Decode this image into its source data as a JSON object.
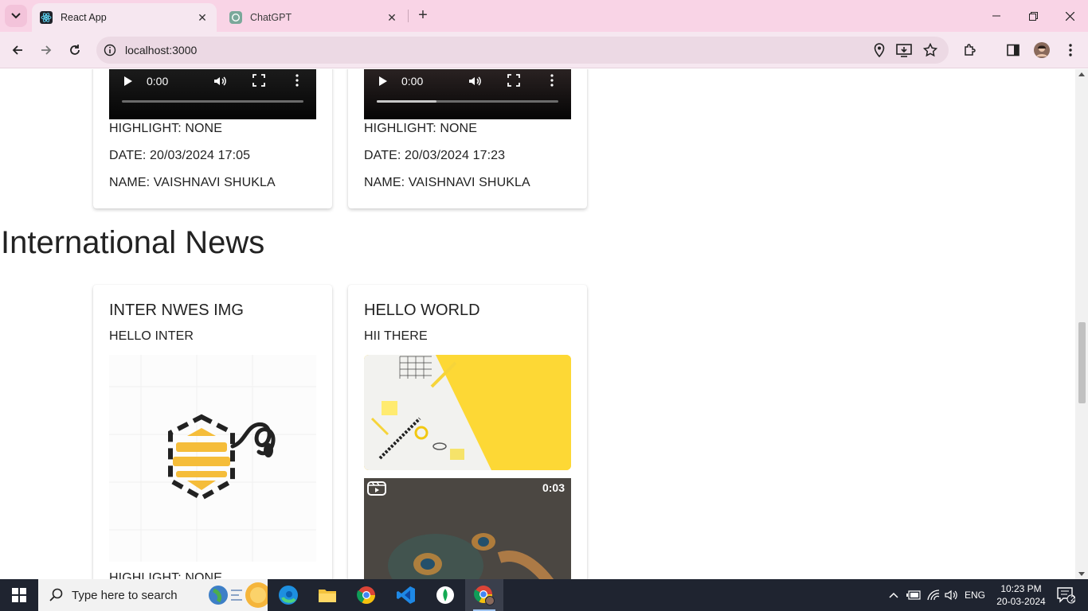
{
  "browser": {
    "tabs": [
      {
        "title": "React App",
        "active": true
      },
      {
        "title": "ChatGPT",
        "active": false
      }
    ],
    "url": "localhost:3000"
  },
  "page": {
    "top_cards": [
      {
        "video_time": "0:00",
        "video_progress": 0.0,
        "highlight": "HIGHLIGHT: NONE",
        "date": "DATE: 20/03/2024 17:05",
        "name": "NAME: VAISHNAVI SHUKLA"
      },
      {
        "video_time": "0:00",
        "video_progress": 0.33,
        "highlight": "HIGHLIGHT: NONE",
        "date": "DATE: 20/03/2024 17:23",
        "name": "NAME: VAISHNAVI SHUKLA"
      }
    ],
    "section_title": "International News",
    "news_cards": [
      {
        "title": "INTER NWES IMG",
        "subtitle": "HELLO INTER",
        "footer": "HIGHLIGHT: NONE"
      },
      {
        "title": "HELLO WORLD",
        "subtitle": "HII THERE",
        "video_duration": "0:03"
      }
    ]
  },
  "taskbar": {
    "search_placeholder": "Type here to search",
    "language": "ENG",
    "time": "10:23 PM",
    "date": "20-03-2024",
    "notification_count": "2"
  },
  "colors": {
    "tabstrip": "#f9d4e6",
    "toolbar": "#f6e7f0",
    "taskbar": "#1f2430"
  }
}
